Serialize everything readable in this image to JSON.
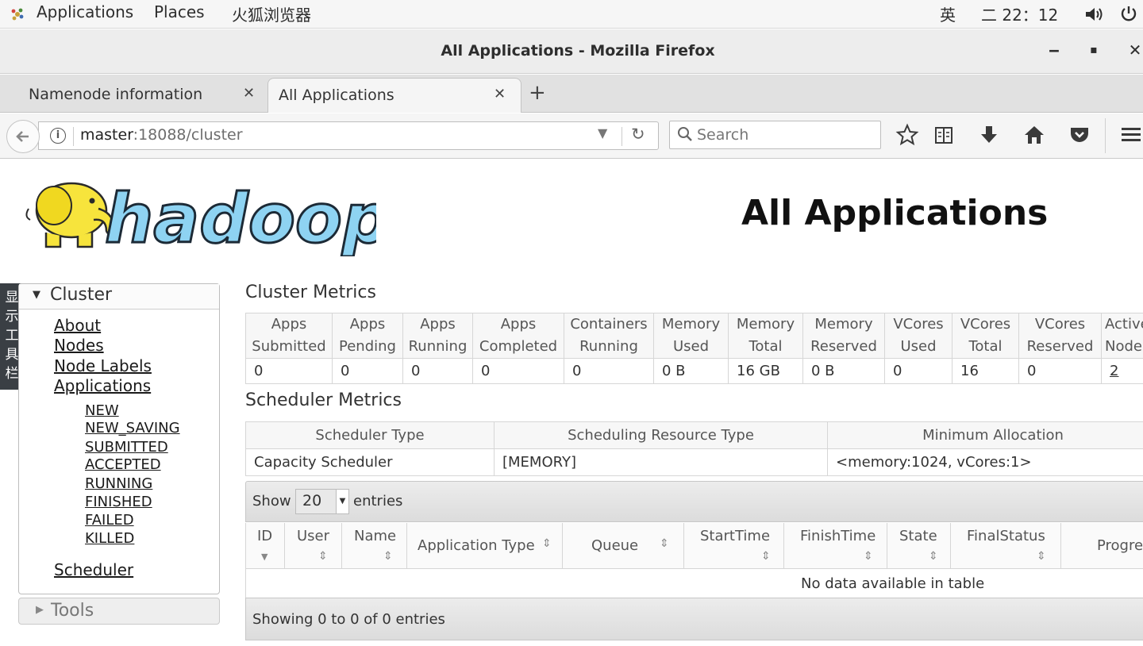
{
  "system_bar": {
    "applications": "Applications",
    "places": "Places",
    "browser_app": "火狐浏览器",
    "input_method": "英",
    "clock": "二 22：12",
    "volume_icon": "volume-icon",
    "power_icon": "power-icon"
  },
  "window": {
    "title": "All Applications - Mozilla Firefox",
    "minimize": "‒",
    "maximize": "▪",
    "close": "✕"
  },
  "tabs": [
    {
      "label": "Namenode information",
      "close": "✕"
    },
    {
      "label": "All Applications",
      "close": "✕"
    }
  ],
  "new_tab": "+",
  "navbar": {
    "url_host": "master",
    "url_path": ":18088/cluster",
    "search_placeholder": "Search"
  },
  "page": {
    "logo_text": "hadoop",
    "title": "All Applications",
    "side_tab": [
      "显",
      "示",
      "工",
      "具",
      "栏"
    ],
    "cluster_panel": {
      "label": "Cluster",
      "links": [
        "About",
        "Nodes",
        "Node Labels",
        "Applications"
      ],
      "app_states": [
        "NEW",
        "NEW_SAVING",
        "SUBMITTED",
        "ACCEPTED",
        "RUNNING",
        "FINISHED",
        "FAILED",
        "KILLED"
      ],
      "scheduler": "Scheduler"
    },
    "tools_panel": {
      "label": "Tools"
    },
    "cluster_metrics": {
      "title": "Cluster Metrics",
      "headers": [
        [
          "Apps",
          "Submitted"
        ],
        [
          "Apps",
          "Pending"
        ],
        [
          "Apps",
          "Running"
        ],
        [
          "Apps",
          "Completed"
        ],
        [
          "Containers",
          "Running"
        ],
        [
          "Memory",
          "Used"
        ],
        [
          "Memory",
          "Total"
        ],
        [
          "Memory",
          "Reserved"
        ],
        [
          "VCores",
          "Used"
        ],
        [
          "VCores",
          "Total"
        ],
        [
          "VCores",
          "Reserved"
        ],
        [
          "Active",
          "Nodes"
        ]
      ],
      "values": [
        "0",
        "0",
        "0",
        "0",
        "0",
        "0 B",
        "16 GB",
        "0 B",
        "0",
        "16",
        "0",
        "2"
      ]
    },
    "scheduler_metrics": {
      "title": "Scheduler Metrics",
      "headers": [
        "Scheduler Type",
        "Scheduling Resource Type",
        "Minimum Allocation"
      ],
      "values": [
        "Capacity Scheduler",
        "[MEMORY]",
        "<memory:1024, vCores:1>"
      ]
    },
    "apps_table": {
      "show_label": "Show",
      "entries_value": "20",
      "entries_label": "entries",
      "columns": [
        "ID",
        "User",
        "Name",
        "Application Type",
        "Queue",
        "StartTime",
        "FinishTime",
        "State",
        "FinalStatus",
        "Progress"
      ],
      "empty_message": "No data available in table",
      "info": "Showing 0 to 0 of 0 entries"
    }
  }
}
